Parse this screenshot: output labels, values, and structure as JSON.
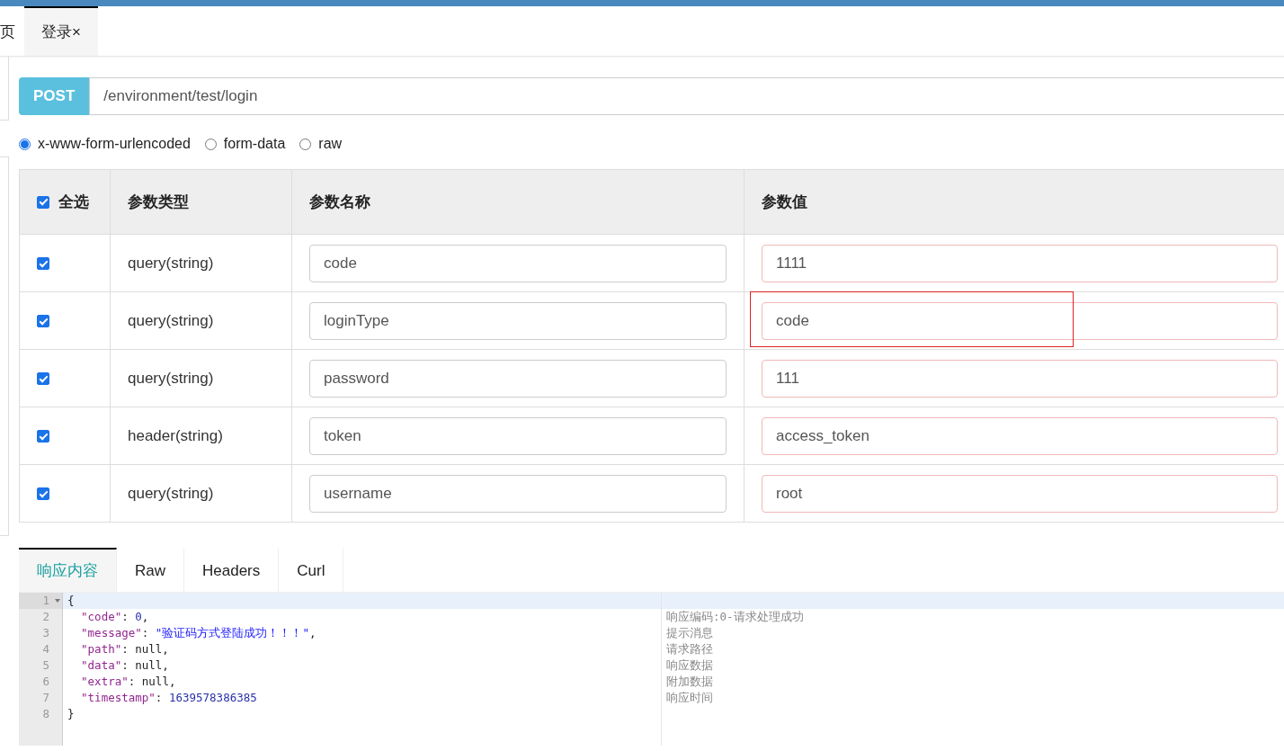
{
  "page_tabs": [
    {
      "label": "页",
      "selected": false
    },
    {
      "label": "登录×",
      "selected": true
    }
  ],
  "request": {
    "method": "POST",
    "url": "/environment/test/login"
  },
  "body_types": [
    {
      "label": "x-www-form-urlencoded",
      "selected": true
    },
    {
      "label": "form-data",
      "selected": false
    },
    {
      "label": "raw",
      "selected": false
    }
  ],
  "params_table": {
    "select_all": {
      "label": "全选",
      "checked": true
    },
    "columns": [
      "参数类型",
      "参数名称",
      "参数值"
    ],
    "rows": [
      {
        "checked": true,
        "type": "query(string)",
        "name": "code",
        "value": "1111",
        "highlighted": false
      },
      {
        "checked": true,
        "type": "query(string)",
        "name": "loginType",
        "value": "code",
        "highlighted": true
      },
      {
        "checked": true,
        "type": "query(string)",
        "name": "password",
        "value": "111",
        "highlighted": false
      },
      {
        "checked": true,
        "type": "header(string)",
        "name": "token",
        "value": "access_token",
        "highlighted": false
      },
      {
        "checked": true,
        "type": "query(string)",
        "name": "username",
        "value": "root",
        "highlighted": false
      }
    ]
  },
  "response_tabs": [
    {
      "label": "响应内容",
      "selected": true
    },
    {
      "label": "Raw",
      "selected": false
    },
    {
      "label": "Headers",
      "selected": false
    },
    {
      "label": "Curl",
      "selected": false
    }
  ],
  "response_code": [
    {
      "number": "1",
      "tokens": [
        {
          "kind": "punct",
          "text": "{"
        }
      ]
    },
    {
      "number": "2",
      "tokens": [
        {
          "kind": "key",
          "text": "\"code\""
        },
        {
          "kind": "punct",
          "text": ": "
        },
        {
          "kind": "number",
          "text": "0"
        },
        {
          "kind": "punct",
          "text": ","
        }
      ],
      "comment": "响应编码:0-请求处理成功"
    },
    {
      "number": "3",
      "tokens": [
        {
          "kind": "key",
          "text": "\"message\""
        },
        {
          "kind": "punct",
          "text": ": "
        },
        {
          "kind": "string",
          "text": "\"验证码方式登陆成功！！！\""
        },
        {
          "kind": "punct",
          "text": ","
        }
      ],
      "comment": "提示消息"
    },
    {
      "number": "4",
      "tokens": [
        {
          "kind": "key",
          "text": "\"path\""
        },
        {
          "kind": "punct",
          "text": ": null,"
        }
      ],
      "comment": "请求路径"
    },
    {
      "number": "5",
      "tokens": [
        {
          "kind": "key",
          "text": "\"data\""
        },
        {
          "kind": "punct",
          "text": ": null,"
        }
      ],
      "comment": "响应数据"
    },
    {
      "number": "6",
      "tokens": [
        {
          "kind": "key",
          "text": "\"extra\""
        },
        {
          "kind": "punct",
          "text": ": null,"
        }
      ],
      "comment": "附加数据"
    },
    {
      "number": "7",
      "tokens": [
        {
          "kind": "key",
          "text": "\"timestamp\""
        },
        {
          "kind": "punct",
          "text": ": "
        },
        {
          "kind": "number",
          "text": "1639578386385"
        }
      ],
      "comment": "响应时间"
    },
    {
      "number": "8",
      "tokens": [
        {
          "kind": "punct",
          "text": "}"
        }
      ]
    }
  ]
}
